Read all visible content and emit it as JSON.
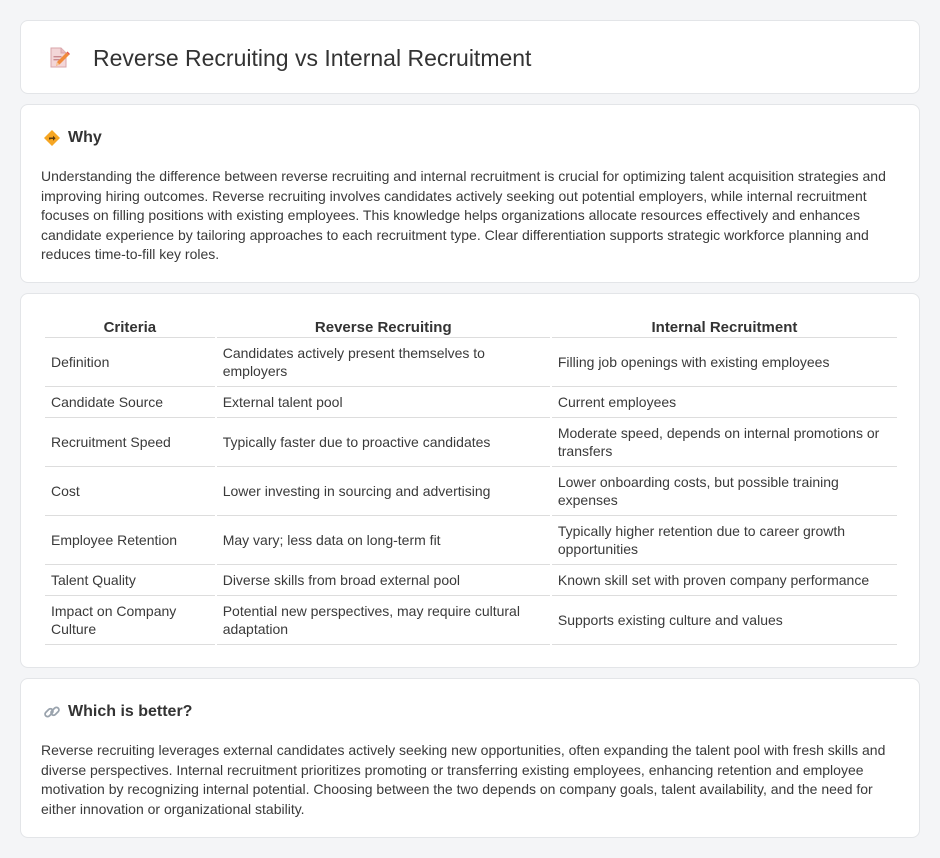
{
  "header": {
    "title": "Reverse Recruiting vs Internal Recruitment",
    "icon": "document-pencil-icon"
  },
  "why": {
    "heading": "Why",
    "icon": "diamond-sign-icon",
    "body": "Understanding the difference between reverse recruiting and internal recruitment is crucial for optimizing talent acquisition strategies and improving hiring outcomes. Reverse recruiting involves candidates actively seeking out potential employers, while internal recruitment focuses on filling positions with existing employees. This knowledge helps organizations allocate resources effectively and enhances candidate experience by tailoring approaches to each recruitment type. Clear differentiation supports strategic workforce planning and reduces time-to-fill key roles."
  },
  "table": {
    "headers": [
      "Criteria",
      "Reverse Recruiting",
      "Internal Recruitment"
    ],
    "rows": [
      [
        "Definition",
        "Candidates actively present themselves to employers",
        "Filling job openings with existing employees"
      ],
      [
        "Candidate Source",
        "External talent pool",
        "Current employees"
      ],
      [
        "Recruitment Speed",
        "Typically faster due to proactive candidates",
        "Moderate speed, depends on internal promotions or transfers"
      ],
      [
        "Cost",
        "Lower investing in sourcing and advertising",
        "Lower onboarding costs, but possible training expenses"
      ],
      [
        "Employee Retention",
        "May vary; less data on long-term fit",
        "Typically higher retention due to career growth opportunities"
      ],
      [
        "Talent Quality",
        "Diverse skills from broad external pool",
        "Known skill set with proven company performance"
      ],
      [
        "Impact on Company Culture",
        "Potential new perspectives, may require cultural adaptation",
        "Supports existing culture and values"
      ]
    ]
  },
  "better": {
    "heading": "Which is better?",
    "icon": "link-icon",
    "body": "Reverse recruiting leverages external candidates actively seeking new opportunities, often expanding the talent pool with fresh skills and diverse perspectives. Internal recruitment prioritizes promoting or transferring existing employees, enhancing retention and employee motivation by recognizing internal potential. Choosing between the two depends on company goals, talent availability, and the need for either innovation or organizational stability."
  }
}
